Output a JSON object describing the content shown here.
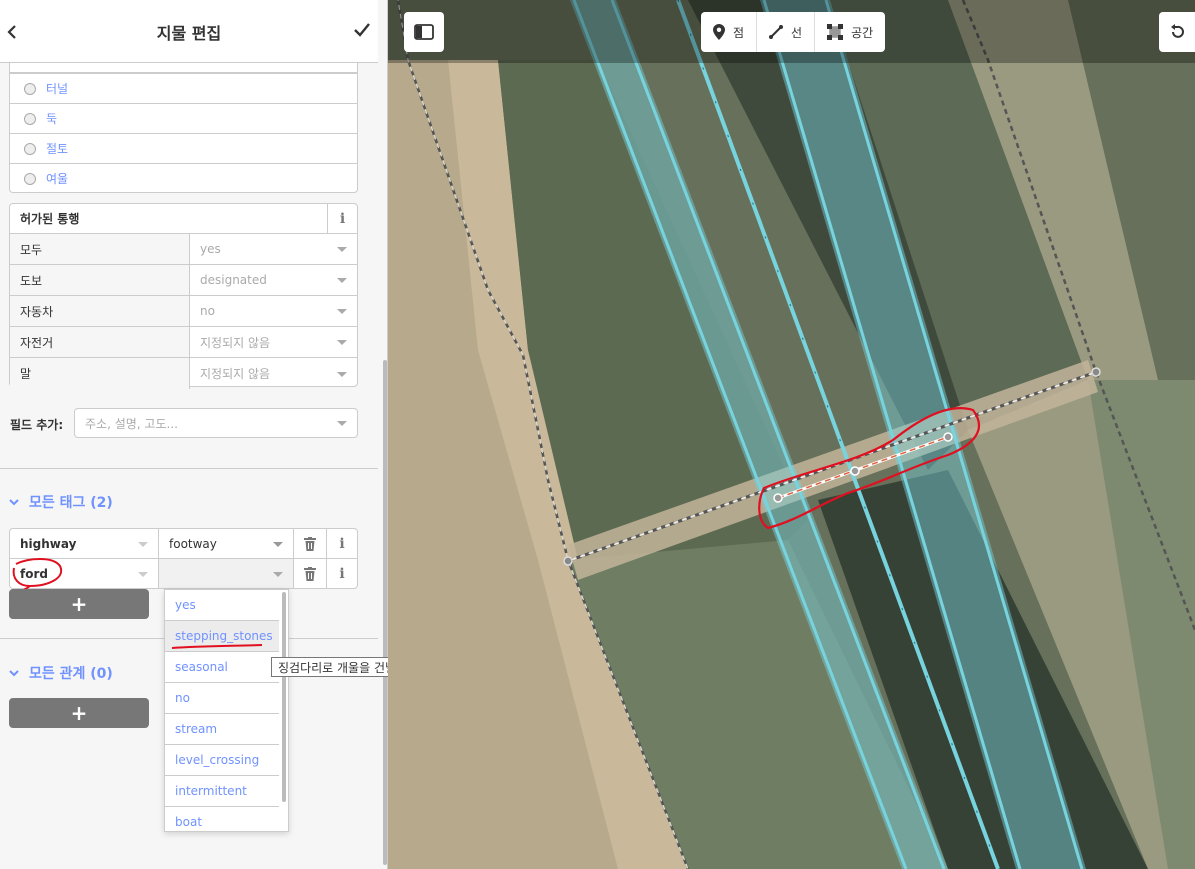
{
  "header": {
    "title": "지물 편집"
  },
  "structure_options": [
    "터널",
    "둑",
    "절토",
    "여울"
  ],
  "access": {
    "title": "허가된 통행",
    "rows": [
      {
        "key": "모두",
        "value": "yes"
      },
      {
        "key": "도보",
        "value": "designated"
      },
      {
        "key": "자동차",
        "value": "no"
      },
      {
        "key": "자전거",
        "value": "지정되지 않음"
      },
      {
        "key": "말",
        "value": "지정되지 않음"
      }
    ]
  },
  "add_field": {
    "label": "필드 추가:",
    "placeholder": "주소, 설명, 고도..."
  },
  "all_tags": {
    "title": "모든 태그 (2)",
    "tags": [
      {
        "key": "highway",
        "value": "footway"
      },
      {
        "key": "ford",
        "value": ""
      }
    ],
    "add_label": "+"
  },
  "ford_dropdown": {
    "options": [
      "yes",
      "stepping_stones",
      "seasonal",
      "no",
      "stream",
      "level_crossing",
      "intermittent",
      "boat"
    ],
    "highlighted": "stepping_stones",
    "tooltip": "징검다리로 개울을 건널 수 있는 얕은 곳."
  },
  "all_relations": {
    "title": "모든 관계 (0)",
    "add_label": "+"
  },
  "map_toolbar": {
    "modes": [
      "점",
      "선",
      "공간"
    ]
  },
  "colors": {
    "accent": "#7092ff",
    "waterway": "#77d3de",
    "annotation": "#e01020"
  },
  "icons": [
    "back-icon",
    "check-icon",
    "info-icon",
    "trash-icon",
    "chevron-down-icon",
    "sidebar-toggle-icon",
    "point-icon",
    "line-icon",
    "area-icon",
    "undo-icon"
  ]
}
